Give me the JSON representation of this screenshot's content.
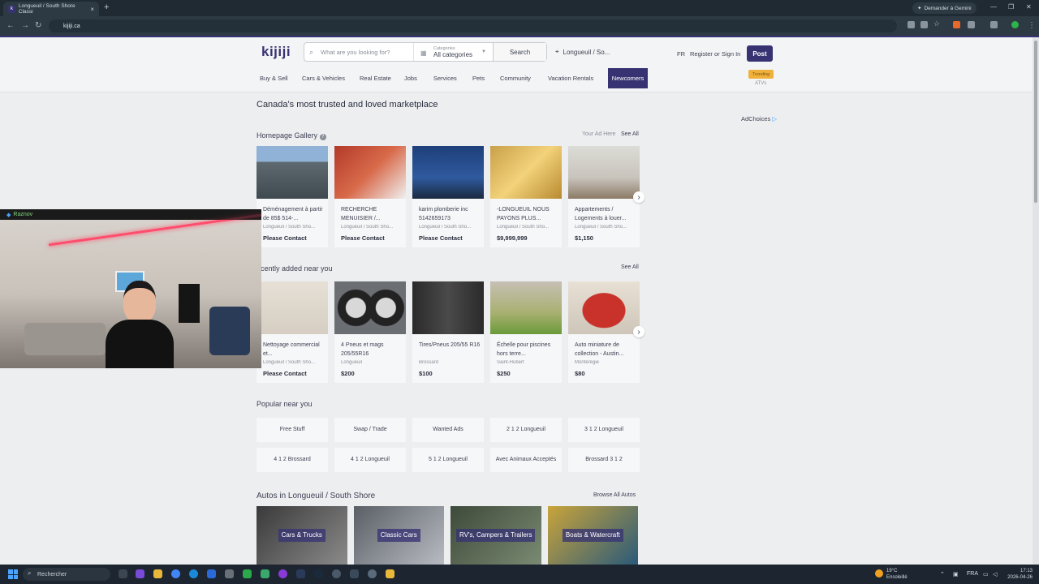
{
  "browser": {
    "tab_title": "Longueuil / South Shore Classi",
    "tab_favicon": "k",
    "new_tab": "+",
    "gemini_button": "Demander à Gemini",
    "url": "kijiji.ca"
  },
  "header": {
    "logo": "kijiji",
    "search_placeholder": "What are you looking for?",
    "categories_label": "Categories",
    "categories_value": "All categories",
    "search_button": "Search",
    "location": "Longueuil / So...",
    "lang": "FR",
    "register": "Register",
    "or": "or",
    "signin": "Sign In",
    "post": "Post",
    "trending": "Trending",
    "atvs": "ATVs"
  },
  "menu": [
    "Buy & Sell",
    "Cars & Vehicles",
    "Real Estate",
    "Jobs",
    "Services",
    "Pets",
    "Community",
    "Vacation Rentals",
    "Newcomers"
  ],
  "main": {
    "hero_title": "Canada's most trusted and loved marketplace",
    "adchoices": "AdChoices",
    "gallery_title": "Homepage Gallery",
    "your_ad_here": "Your Ad Here",
    "see_all": "See All",
    "recent_title": "ecently added near you",
    "popular_title": "Popular near you",
    "autos_title": "Autos in Longueuil / South Shore",
    "browse_autos": "Browse All Autos"
  },
  "gallery": [
    {
      "title": "Déménagement à partir de 85$ 514-...",
      "location": "Longueuil / South Sho...",
      "price": "Please Contact"
    },
    {
      "title": "RECHERCHE MENUISIER /...",
      "location": "Longueuil / South Sho...",
      "price": "Please Contact"
    },
    {
      "title": "karim plomberie inc 5142659173",
      "location": "Longueuil / South Sho...",
      "price": "Please Contact"
    },
    {
      "title": "-LONGUEUIL NOUS PAYONS PLUS...",
      "location": "Longueuil / South Sho...",
      "price": "$9,999,999"
    },
    {
      "title": "Appartements / Logements à louer...",
      "location": "Longueuil / South Sho...",
      "price": "$1,150"
    }
  ],
  "recent": [
    {
      "title": "Nettoyage commercial et...",
      "location": "Longueuil / South Sho...",
      "price": "Please Contact"
    },
    {
      "title": "4 Pneus et mags 205/55R16",
      "location": "Longueuil",
      "price": "$200"
    },
    {
      "title": "Tires/Pneus 205/55 R16",
      "location": "Brossard",
      "price": "$100"
    },
    {
      "title": "Échelle pour piscines hors terre...",
      "location": "Saint-Hubert",
      "price": "$250"
    },
    {
      "title": "Auto miniature de collection - Austin...",
      "location": "Montérégie",
      "price": "$80"
    }
  ],
  "popular": [
    "Free Stuff",
    "Swap / Trade",
    "Wanted Ads",
    "2 1 2 Longueuil",
    "3 1 2 Longueuil",
    "4 1 2 Brossard",
    "4 1 2 Longueuil",
    "5 1 2 Longueuil",
    "Avec Animaux Acceptés",
    "Brossard 3 1 2"
  ],
  "autos": [
    "Cars & Trucks",
    "Classic Cars",
    "RV's, Campers & Trailers",
    "Boats & Watercraft"
  ],
  "webcam": {
    "name": "Raznov"
  },
  "taskbar": {
    "search": "Rechercher",
    "temp": "19°C",
    "weather": "Ensoleillé",
    "lang": "FRA",
    "time": "17:13",
    "date": "2026-04-26"
  },
  "colors": {
    "brand": "#373373",
    "trending": "#f0b13c"
  }
}
